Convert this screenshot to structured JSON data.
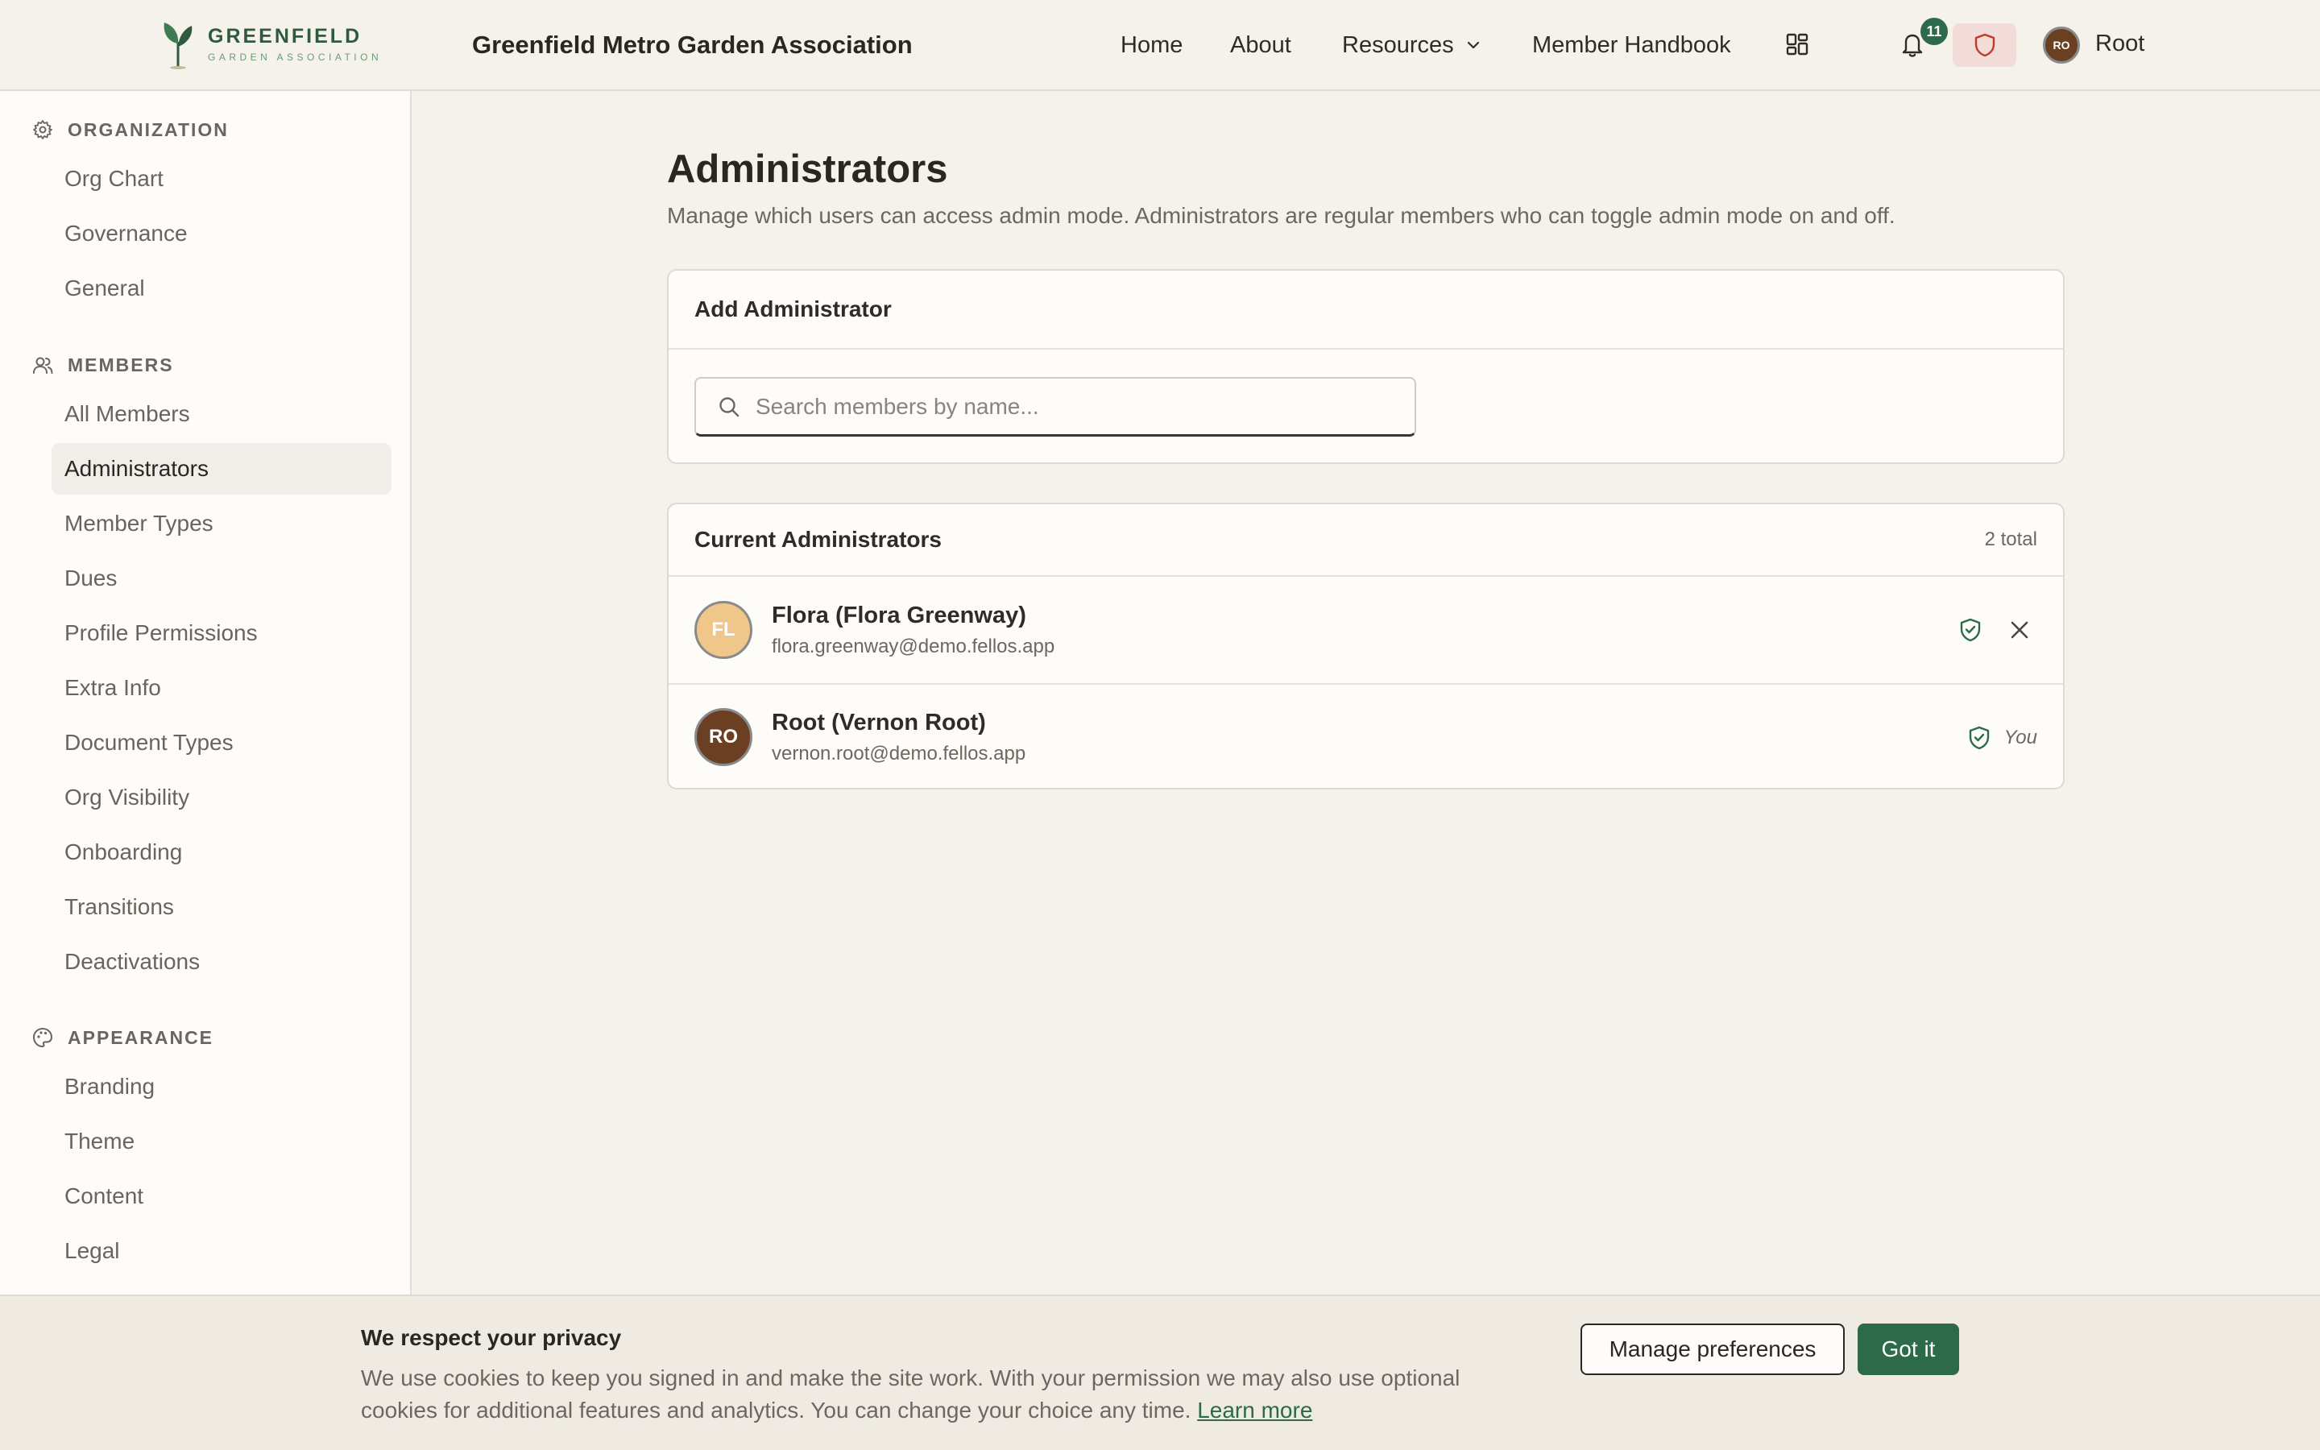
{
  "header": {
    "logo": {
      "main": "GREENFIELD",
      "sub": "GARDEN ASSOCIATION"
    },
    "site_title": "Greenfield Metro Garden Association",
    "nav": {
      "home": "Home",
      "about": "About",
      "resources": "Resources",
      "handbook": "Member Handbook"
    },
    "icons": {
      "apps": "grid-icon",
      "notifications": "bell-icon",
      "admin_mode": "shield-icon",
      "dropdown": "chevron-down-icon"
    },
    "notification_count": "11",
    "user": {
      "initials": "RO",
      "name": "Root"
    }
  },
  "sidebar": {
    "sections": [
      {
        "title": "ORGANIZATION",
        "icon": "gear-icon",
        "items": [
          "Org Chart",
          "Governance",
          "General"
        ]
      },
      {
        "title": "MEMBERS",
        "icon": "users-icon",
        "items": [
          "All Members",
          "Administrators",
          "Member Types",
          "Dues",
          "Profile Permissions",
          "Extra Info",
          "Document Types",
          "Org Visibility",
          "Onboarding",
          "Transitions",
          "Deactivations"
        ]
      },
      {
        "title": "APPEARANCE",
        "icon": "palette-icon",
        "items": [
          "Branding",
          "Theme",
          "Content",
          "Legal"
        ]
      }
    ],
    "active_item": "Administrators"
  },
  "main": {
    "title": "Administrators",
    "description": "Manage which users can access admin mode. Administrators are regular members who can toggle admin mode on and off.",
    "add_card": {
      "title": "Add Administrator",
      "search_placeholder": "Search members by name...",
      "search_value": ""
    },
    "current_card": {
      "title": "Current Administrators",
      "total": "2 total",
      "admins": [
        {
          "initials": "FL",
          "name": "Flora (Flora Greenway)",
          "email": "flora.greenway@demo.fellos.app",
          "removable": true
        },
        {
          "initials": "RO",
          "name": "Root (Vernon Root)",
          "email": "vernon.root@demo.fellos.app",
          "you_label": "You"
        }
      ]
    }
  },
  "cookie": {
    "title": "We respect your privacy",
    "text": "We use cookies to keep you signed in and make the site work. With your permission we may also use optional cookies for additional features and analytics. You can change your choice any time.",
    "link": "Learn more",
    "manage_label": "Manage preferences",
    "accept_label": "Got it"
  },
  "colors": {
    "brand": "#2d6a4a",
    "admin_toggle_bg": "#f2dcd8",
    "admin_toggle_icon": "#c0392b",
    "background": "#f5f1eb"
  }
}
